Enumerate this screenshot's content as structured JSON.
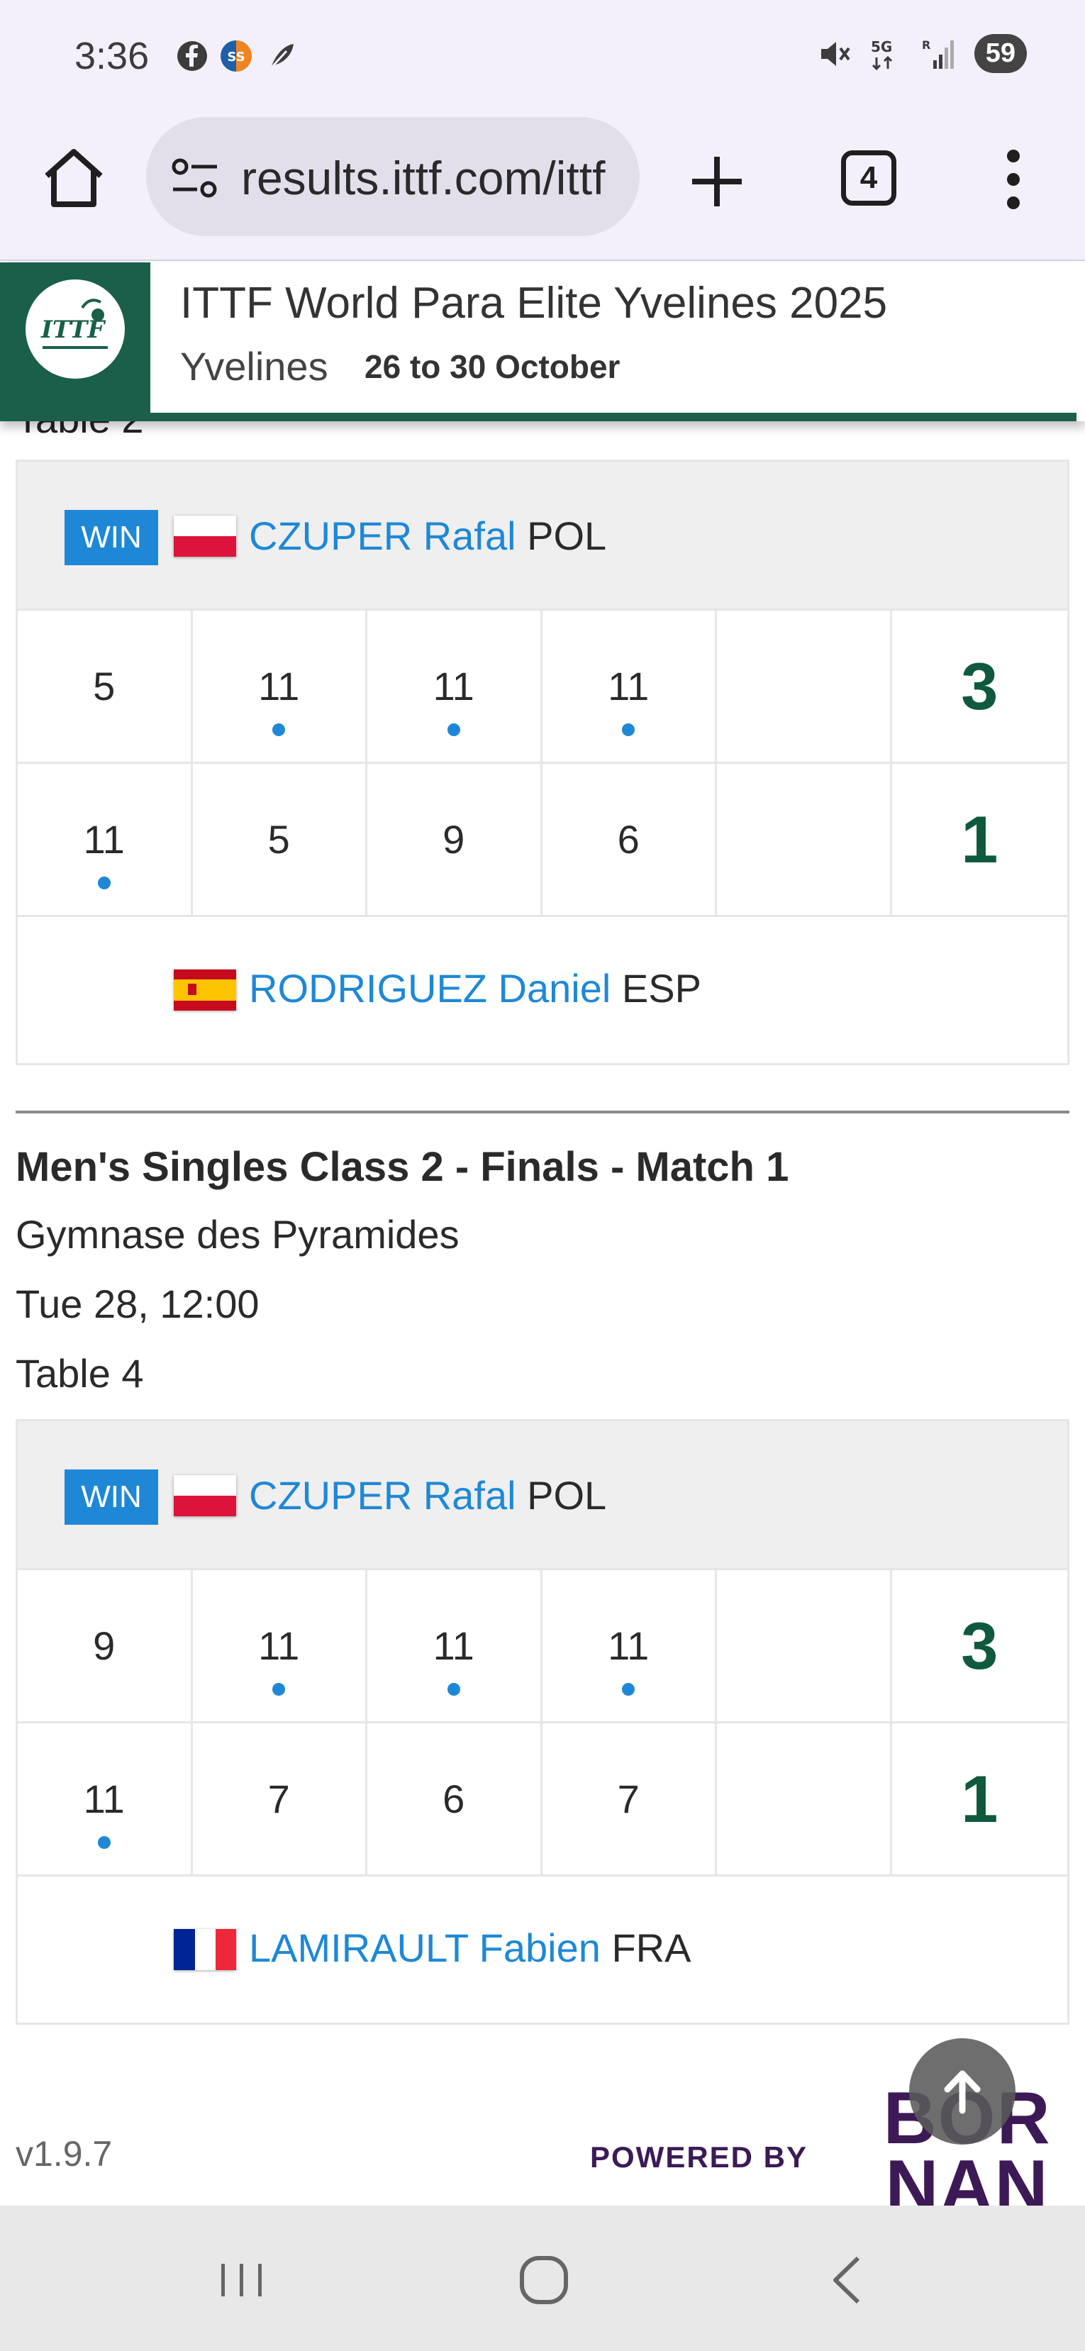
{
  "status_bar": {
    "time": "3:36",
    "battery": "59"
  },
  "browser": {
    "url": "results.ittf.com/ittf",
    "tab_count": "4"
  },
  "event_header": {
    "logo_text": "ITTF",
    "title": "ITTF World Para Elite Yvelines 2025",
    "location": "Yvelines",
    "dates": "26 to 30 October"
  },
  "cut_off_text": "Table 2",
  "matches": [
    {
      "winner": {
        "badge": "WIN",
        "name": "CZUPER Rafal",
        "country": "POL",
        "games": [
          "5",
          "11",
          "11",
          "11",
          ""
        ],
        "total": "3"
      },
      "loser": {
        "name": "RODRIGUEZ Daniel",
        "country": "ESP",
        "games": [
          "11",
          "5",
          "9",
          "6",
          ""
        ],
        "total": "1"
      }
    },
    {
      "title": "Men's Singles Class 2 - Finals - Match 1",
      "venue": "Gymnase des Pyramides",
      "datetime": "Tue 28, 12:00",
      "table": "Table 4",
      "winner": {
        "badge": "WIN",
        "name": "CZUPER Rafal",
        "country": "POL",
        "games": [
          "9",
          "11",
          "11",
          "11",
          ""
        ],
        "total": "3"
      },
      "loser": {
        "name": "LAMIRAULT Fabien",
        "country": "FRA",
        "games": [
          "11",
          "7",
          "6",
          "7",
          ""
        ],
        "total": "1"
      }
    }
  ],
  "footer": {
    "version": "v1.9.7",
    "powered_by": "POWERED BY",
    "brand_line1": "BOR",
    "brand_line2": "NAN"
  },
  "colors": {
    "accent_blue": "#1e88d6",
    "ittf_green": "#1a5f4a",
    "score_green": "#0f5a3c",
    "brand_purple": "#3d1a56"
  }
}
